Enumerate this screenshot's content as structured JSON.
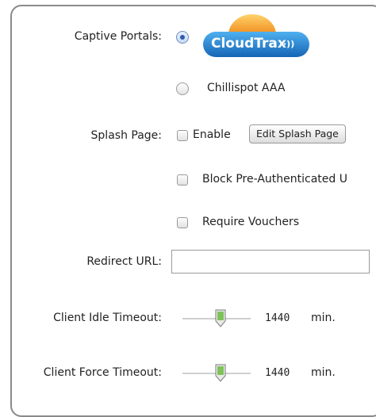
{
  "captive_portals": {
    "label": "Captive Portals:",
    "options": [
      {
        "name": "CloudTrax",
        "selected": true,
        "logo_text": "CloudTrax",
        "logo_suffix": "·))"
      },
      {
        "name": "Chillispot AAA",
        "selected": false,
        "label": "Chillispot AAA"
      }
    ]
  },
  "splash_page": {
    "label": "Splash Page:",
    "enable_label": "Enable",
    "enable_checked": false,
    "edit_button": "Edit Splash Page",
    "block_label": "Block Pre-Authenticated U",
    "block_checked": false,
    "vouchers_label": "Require Vouchers",
    "vouchers_checked": false
  },
  "redirect_url": {
    "label": "Redirect URL:",
    "value": ""
  },
  "client_idle_timeout": {
    "label": "Client Idle Timeout:",
    "value": "1440",
    "unit": "min."
  },
  "client_force_timeout": {
    "label": "Client Force Timeout:",
    "value": "1440",
    "unit": "min."
  },
  "colors": {
    "logo_blue": "#1e7fd0",
    "logo_sun": "#f4b233",
    "thumb_green": "#7fc25a"
  }
}
